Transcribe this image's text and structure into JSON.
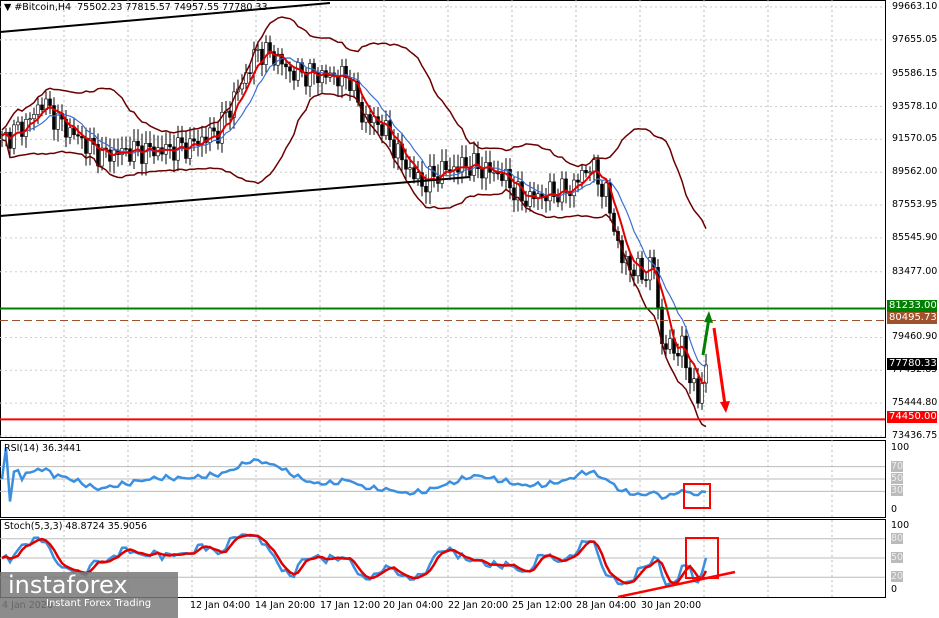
{
  "header": {
    "symbol": "#Bitcoin,H4",
    "ohlc": "75502.23 77815.57 74957.55 77780.33"
  },
  "price_axis": [
    "99663.10",
    "97655.05",
    "95586.15",
    "93578.10",
    "91570.05",
    "89562.00",
    "87553.95",
    "85545.90",
    "83477.00",
    "79460.90",
    "77452.85",
    "75444.80",
    "73436.75"
  ],
  "tags": {
    "green": "81233.00",
    "brown": "80495.73",
    "current": "77780.33",
    "red": "74450.00"
  },
  "colors": {
    "green": "#007f00",
    "brown": "#a0522d",
    "red": "#ff0000",
    "bb": "#6b0000",
    "ma_red": "#e00000",
    "ma_blue": "#3c6fd6",
    "rsi": "#3a8fe0"
  },
  "rsi": {
    "label": "RSI(14) 36.3441",
    "levels": [
      "100",
      "70",
      "50",
      "30",
      "0"
    ]
  },
  "stoch": {
    "label": "Stoch(5,3,3) 48.8724 35.9056",
    "levels": [
      "100",
      "80",
      "50",
      "20",
      "0"
    ]
  },
  "time_axis": [
    "4 Jan 2026",
    "12 Jan 04:00",
    "14 Jan 20:00",
    "17 Jan 12:00",
    "20 Jan 04:00",
    "22 Jan 20:00",
    "25 Jan 12:00",
    "28 Jan 04:00",
    "30 Jan 20:00"
  ],
  "logo": {
    "name": "instaforex",
    "tagline": "Instant Forex Trading"
  },
  "chart_data": {
    "type": "candlestick",
    "title": "#Bitcoin,H4",
    "ylim": [
      73436.75,
      99663.1
    ],
    "key_closes": [
      [
        0,
        91500
      ],
      [
        7,
        92750
      ],
      [
        10,
        93900
      ],
      [
        15,
        92450
      ],
      [
        20,
        91500
      ],
      [
        25,
        90600
      ],
      [
        32,
        90900
      ],
      [
        40,
        90900
      ],
      [
        47,
        91200
      ],
      [
        54,
        92100
      ],
      [
        59,
        94600
      ],
      [
        64,
        97000
      ],
      [
        68,
        96700
      ],
      [
        72,
        95700
      ],
      [
        80,
        95500
      ],
      [
        87,
        95300
      ],
      [
        90,
        93000
      ],
      [
        95,
        92400
      ],
      [
        100,
        90300
      ],
      [
        105,
        88800
      ],
      [
        110,
        89700
      ],
      [
        117,
        90000
      ],
      [
        125,
        89400
      ],
      [
        130,
        87900
      ],
      [
        136,
        88200
      ],
      [
        142,
        88500
      ],
      [
        147,
        90000
      ],
      [
        151,
        88200
      ],
      [
        155,
        84200
      ],
      [
        160,
        83300
      ],
      [
        163,
        83900
      ],
      [
        165,
        79000
      ],
      [
        170,
        78700
      ],
      [
        174,
        75600
      ],
      [
        176,
        77780
      ]
    ],
    "hlines": [
      81233.0,
      80495.73,
      74450.0
    ]
  }
}
